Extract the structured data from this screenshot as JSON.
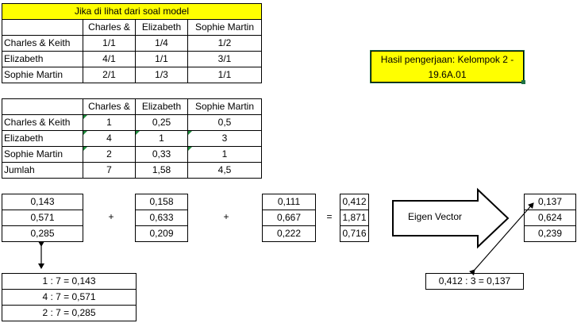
{
  "table1": {
    "title": "Jika di lihat dari soal model",
    "headers": [
      "Charles &",
      "Elizabeth",
      "Sophie Martin"
    ],
    "rows": [
      {
        "label": "Charles & Keith",
        "values": [
          "1/1",
          "1/4",
          "1/2"
        ]
      },
      {
        "label": "Elizabeth",
        "values": [
          "4/1",
          "1/1",
          "3/1"
        ]
      },
      {
        "label": "Sophie Martin",
        "values": [
          "2/1",
          "1/3",
          "1/1"
        ]
      }
    ]
  },
  "table2": {
    "headers": [
      "Charles &",
      "Elizabeth",
      "Sophie Martin"
    ],
    "rows": [
      {
        "label": "Charles & Keith",
        "values": [
          "1",
          "0,25",
          "0,5"
        ]
      },
      {
        "label": "Elizabeth",
        "values": [
          "4",
          "1",
          "3"
        ]
      },
      {
        "label": "Sophie Martin",
        "values": [
          "2",
          "0,33",
          "1"
        ]
      },
      {
        "label": "Jumlah",
        "values": [
          "7",
          "1,58",
          "4,5"
        ]
      }
    ]
  },
  "note": {
    "line1": "Hasil pengerjaan: Kelompok 2 -",
    "line2": "19.6A.01"
  },
  "vectors": {
    "v1": [
      "0,143",
      "0,571",
      "0,285"
    ],
    "v2": [
      "0,158",
      "0,633",
      "0,209"
    ],
    "v3": [
      "0,111",
      "0,667",
      "0,222"
    ],
    "sum": [
      "0,412",
      "1,871",
      "0,716"
    ],
    "eigen": [
      "0,137",
      "0,624",
      "0,239"
    ],
    "plus1": "+",
    "plus2": "+",
    "equals": "="
  },
  "eigen_label": "Eigen Vector",
  "calc1": [
    "1 : 7 = 0,143",
    "4 : 7 = 0,571",
    "2 : 7 = 0,285"
  ],
  "calc2": "0,412 : 3 = 0,137",
  "colors": {
    "highlight": "#ffff00",
    "selection": "#1e7145",
    "indicator": "#1e8a3c"
  }
}
